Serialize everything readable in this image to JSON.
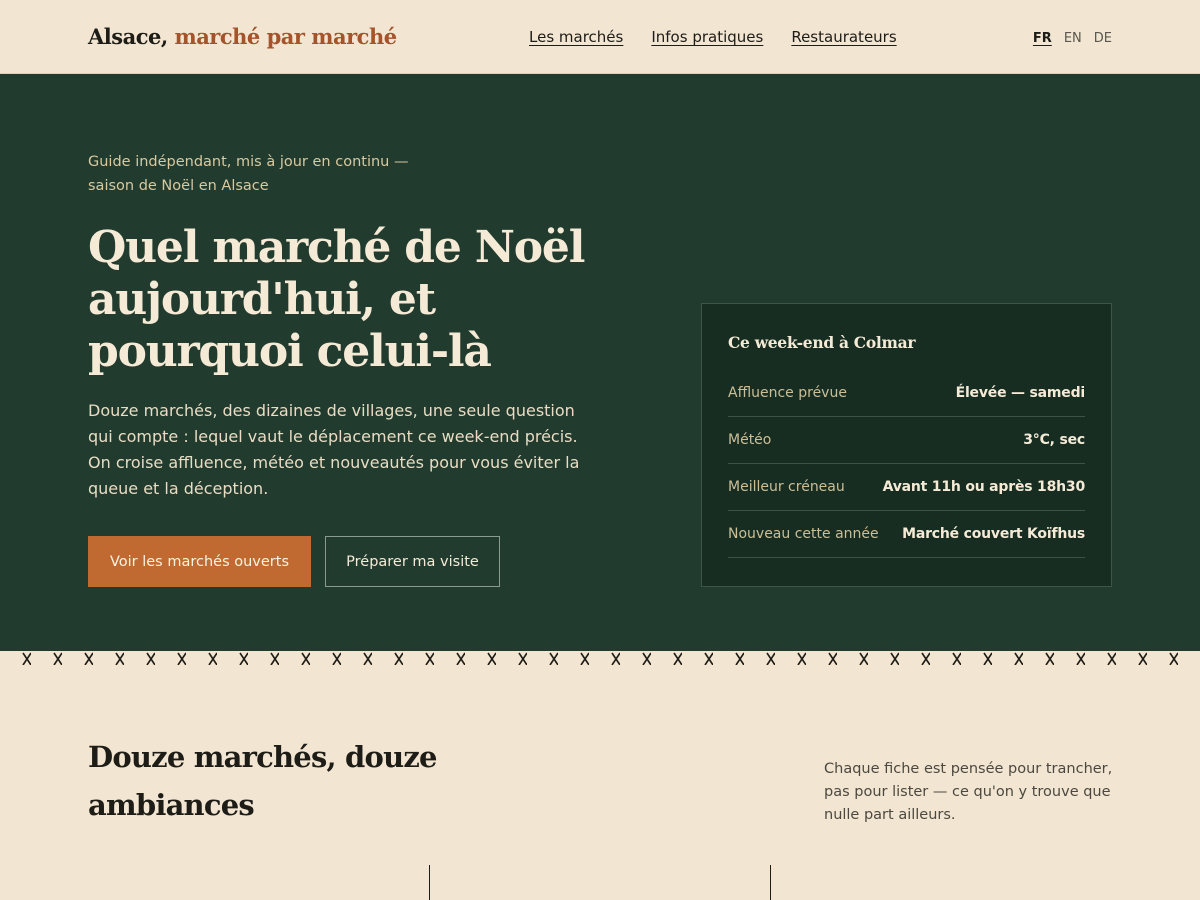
{
  "header": {
    "logo_main": "Alsace,",
    "logo_accent": "marché par marché",
    "nav": [
      "Les marchés",
      "Infos pratiques",
      "Restaurateurs"
    ],
    "languages": [
      "FR",
      "EN",
      "DE"
    ],
    "active_language": "FR"
  },
  "hero": {
    "kicker": "Guide indépendant, mis à jour en continu — saison de Noël en Alsace",
    "title": "Quel marché de Noël aujourd'hui, et pourquoi celui-là",
    "text": "Douze marchés, des dizaines de villages, une seule question qui compte : lequel vaut le déplacement ce week-end précis. On croise affluence, météo et nouveautés pour vous éviter la queue et la déception.",
    "primary_cta": "Voir les marchés ouverts",
    "secondary_cta": "Préparer ma visite"
  },
  "weekend_card": {
    "title": "Ce week-end à Colmar",
    "rows": [
      {
        "label": "Affluence prévue",
        "value": "Élevée — samedi"
      },
      {
        "label": "Météo",
        "value": "3°C, sec"
      },
      {
        "label": "Meilleur créneau",
        "value": "Avant 11h ou après 18h30"
      },
      {
        "label": "Nouveau cette année",
        "value": "Marché couvert Koïfhus"
      }
    ]
  },
  "section": {
    "title": "Douze marchés, douze ambiances",
    "note": "Chaque fiche est pensée pour trancher, pas pour lister — ce qu'on y trouve que nulle part ailleurs."
  },
  "colors": {
    "background": "#f2e6d3",
    "hero_green": "#213b2e",
    "card_green": "#172d22",
    "accent_orange": "#c06a32",
    "accent_rust": "#a5532a"
  }
}
